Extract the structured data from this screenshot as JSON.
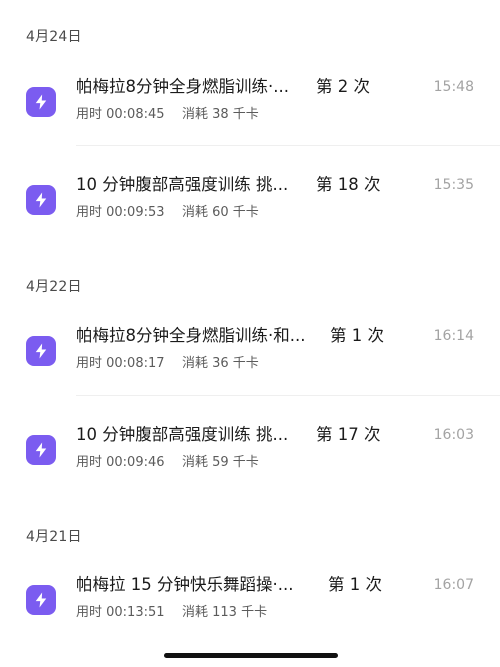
{
  "groups": [
    {
      "date": "4月24日",
      "records": [
        {
          "title": "帕梅拉8分钟全身燃脂训练·...",
          "count": "第 2 次",
          "time": "15:48",
          "duration": "用时 00:08:45",
          "calories": "消耗 38 千卡"
        },
        {
          "title": "10 分钟腹部高强度训练 挑...",
          "count": "第 18 次",
          "time": "15:35",
          "duration": "用时 00:09:53",
          "calories": "消耗 60 千卡"
        }
      ]
    },
    {
      "date": "4月22日",
      "records": [
        {
          "title": "帕梅拉8分钟全身燃脂训练·和...",
          "count": "第 1 次",
          "time": "16:14",
          "duration": "用时 00:08:17",
          "calories": "消耗 36 千卡"
        },
        {
          "title": "10 分钟腹部高强度训练 挑...",
          "count": "第 17 次",
          "time": "16:03",
          "duration": "用时 00:09:46",
          "calories": "消耗 59 千卡"
        }
      ]
    },
    {
      "date": "4月21日",
      "records": [
        {
          "title": "帕梅拉 15 分钟快乐舞蹈操·...",
          "count": "第 1 次",
          "time": "16:07",
          "duration": "用时 00:13:51",
          "calories": "消耗 113 千卡"
        }
      ]
    }
  ],
  "icon": {
    "name": "lightning-icon",
    "color": "#7b5cf0"
  }
}
